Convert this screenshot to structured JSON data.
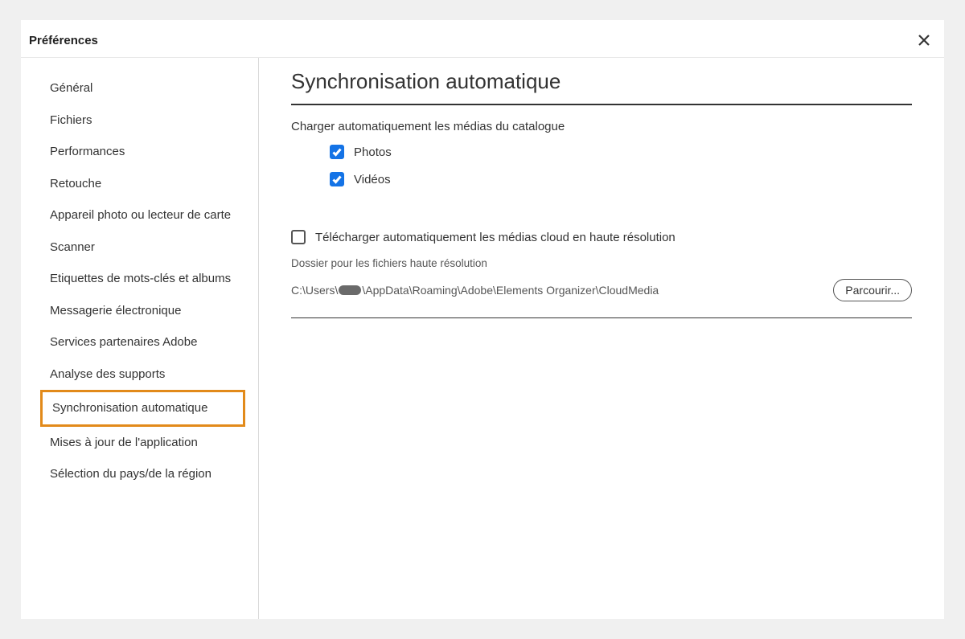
{
  "dialog": {
    "title": "Préférences"
  },
  "sidebar": {
    "items": [
      {
        "label": "Général"
      },
      {
        "label": "Fichiers"
      },
      {
        "label": "Performances"
      },
      {
        "label": "Retouche"
      },
      {
        "label": "Appareil photo ou lecteur de carte"
      },
      {
        "label": "Scanner"
      },
      {
        "label": "Etiquettes de mots-clés et albums"
      },
      {
        "label": "Messagerie électronique"
      },
      {
        "label": "Services partenaires Adobe"
      },
      {
        "label": "Analyse des supports"
      },
      {
        "label": "Synchronisation automatique"
      },
      {
        "label": "Mises à jour de l'application"
      },
      {
        "label": "Sélection du pays/de la région"
      }
    ]
  },
  "main": {
    "heading": "Synchronisation automatique",
    "auto_upload_label": "Charger automatiquement les médias du catalogue",
    "photos_label": "Photos",
    "videos_label": "Vidéos",
    "auto_download_label": "Télécharger automatiquement les médias cloud en haute résolution",
    "folder_label": "Dossier pour les fichiers haute résolution",
    "folder_path_prefix": "C:\\Users\\",
    "folder_path_suffix": "\\AppData\\Roaming\\Adobe\\Elements Organizer\\CloudMedia",
    "browse_label": "Parcourir..."
  }
}
